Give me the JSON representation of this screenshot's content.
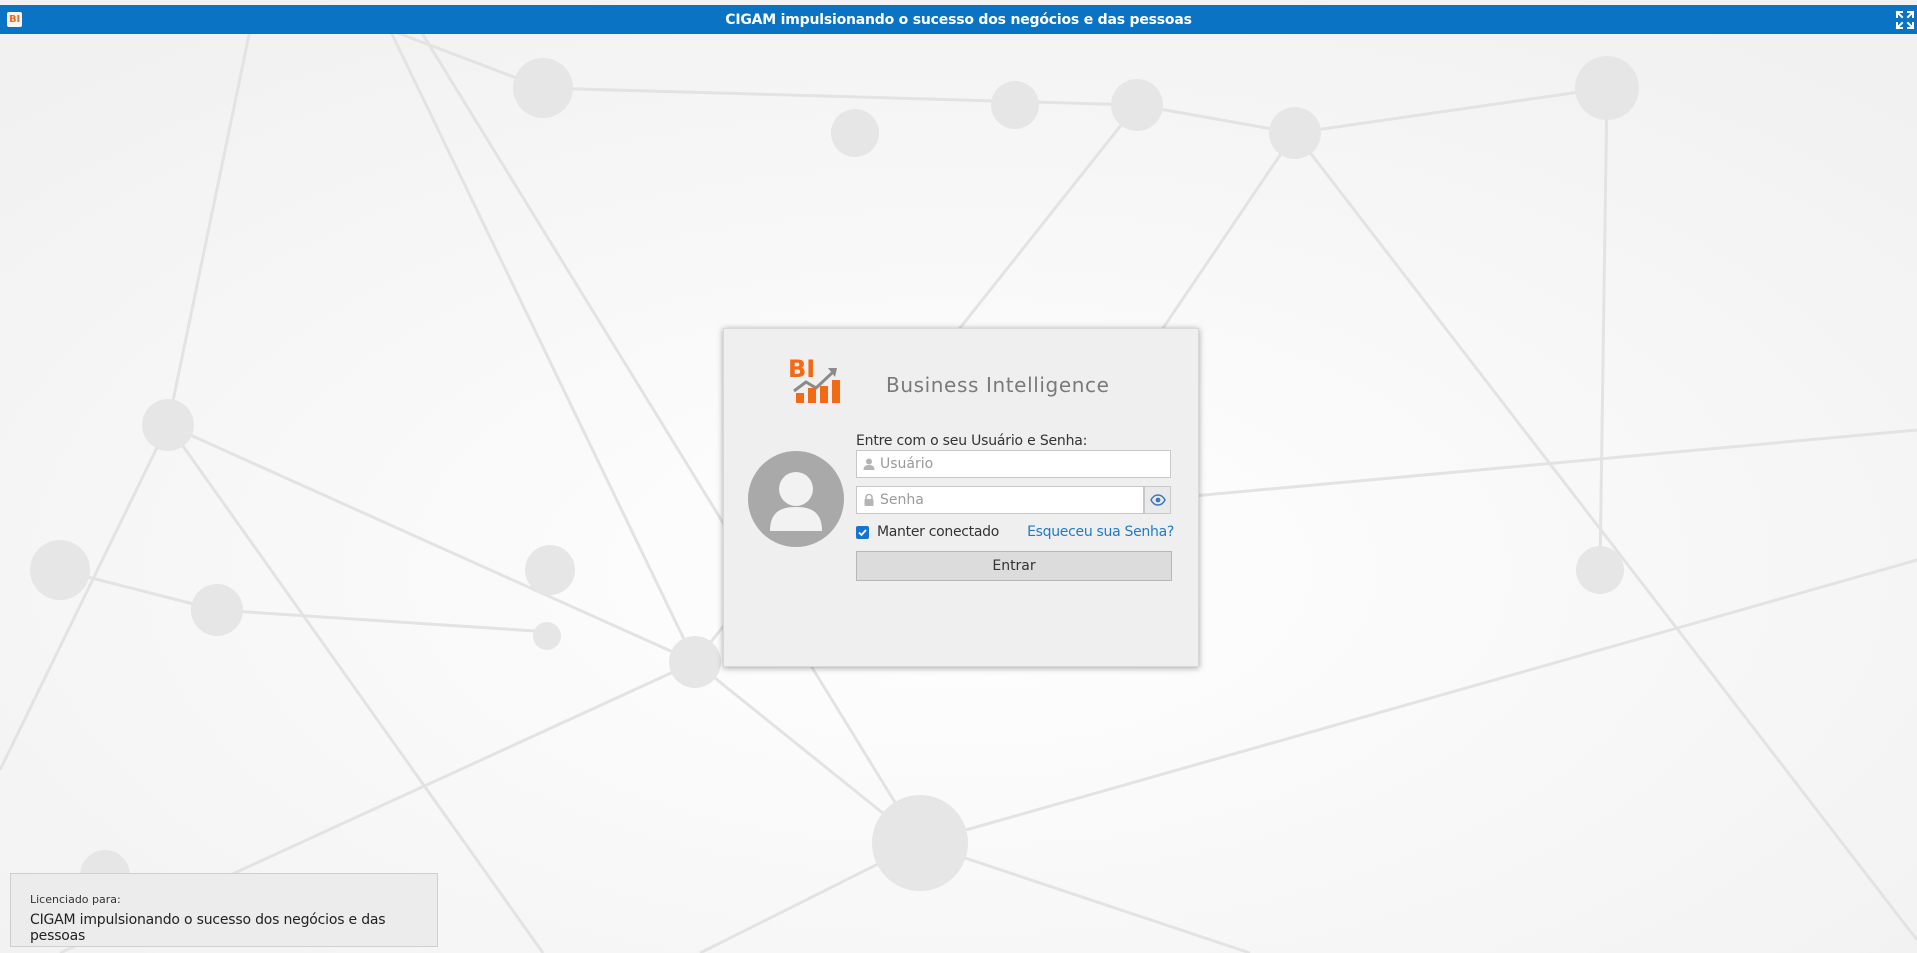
{
  "header": {
    "logo_text": "BI",
    "title": "CIGAM impulsionando o sucesso dos negócios e das pessoas",
    "fullscreen_icon": "expand-icon"
  },
  "login": {
    "brand_logo_text": "BI",
    "brand_title": "Business Intelligence",
    "prompt": "Entre com o seu Usuário e Senha:",
    "username_placeholder": "Usuário",
    "password_placeholder": "Senha",
    "remember_label": "Manter conectado",
    "remember_checked": true,
    "forgot_link": "Esqueceu sua Senha?",
    "submit_label": "Entrar",
    "icons": {
      "avatar": "user-avatar-icon",
      "username": "user-icon",
      "password": "lock-icon",
      "show_password": "eye-icon"
    }
  },
  "license": {
    "label": "Licenciado para:",
    "value": "CIGAM impulsionando o sucesso dos negócios e das pessoas"
  },
  "colors": {
    "header_bg": "#0a73c4",
    "accent_orange": "#f26a16",
    "link_blue": "#1f7ac9",
    "checkbox_blue": "#1674d1"
  }
}
